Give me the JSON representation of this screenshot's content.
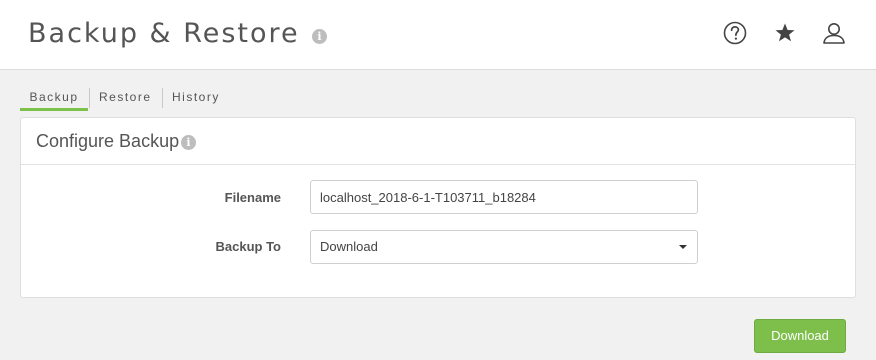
{
  "header": {
    "title": "Backup & Restore",
    "info_icon": "info-circle-icon",
    "actions": [
      {
        "name": "help",
        "icon": "question-circle-icon"
      },
      {
        "name": "favorite",
        "icon": "star-icon"
      },
      {
        "name": "user",
        "icon": "user-icon"
      }
    ]
  },
  "tabs": [
    {
      "label": "Backup",
      "active": true
    },
    {
      "label": "Restore",
      "active": false
    },
    {
      "label": "History",
      "active": false
    }
  ],
  "panel": {
    "title": "Configure Backup",
    "fields": {
      "filename": {
        "label": "Filename",
        "value": "localhost_2018-6-1-T103711_b18284"
      },
      "backup_to": {
        "label": "Backup To",
        "value": "Download"
      }
    }
  },
  "actions": {
    "download_label": "Download"
  },
  "colors": {
    "accent": "#7cc24a",
    "button": "#7dbf4a",
    "background": "#f1f1f1"
  }
}
